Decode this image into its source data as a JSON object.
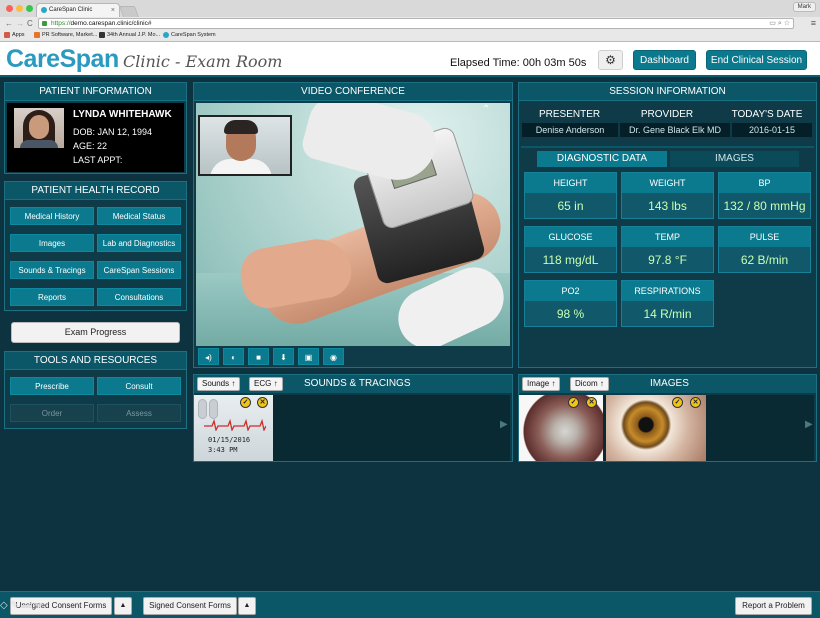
{
  "browser": {
    "tab_title": "CareSpan Clinic",
    "tab_close": "×",
    "profile": "Mark",
    "url_scheme": "https://",
    "url_rest": "demo.carespan.clinic/clinic#",
    "url_icons": "▭ ⌕ ☆",
    "menu_icon": "≡",
    "nav_back": "←",
    "nav_forward": "→",
    "nav_reload": "C",
    "bookmarks": [
      "Apps",
      "PR Software, Market...",
      "34th Annual J.P. Mo...",
      "CareSpan System"
    ]
  },
  "header": {
    "brand": "CareSpan",
    "subtitle": "Clinic - Exam Room",
    "elapsed": "Elapsed Time: 00h 03m 50s",
    "gear": "⚙",
    "dashboard_label": "Dashboard",
    "end_session_label": "End Clinical Session"
  },
  "patient": {
    "heading": "PATIENT INFORMATION",
    "name": "LYNDA WHITEHAWK",
    "dob": "DOB: JAN 12, 1994",
    "age": "AGE: 22",
    "last_appt": "LAST APPT:"
  },
  "health_record": {
    "heading": "PATIENT HEALTH RECORD",
    "buttons": [
      "Medical History",
      "Medical Status",
      "Images",
      "Lab and Diagnostics",
      "Sounds & Tracings",
      "CareSpan Sessions",
      "Reports",
      "Consultations"
    ]
  },
  "exam_progress": "Exam Progress",
  "tools": {
    "heading": "TOOLS AND RESOURCES",
    "prescribe": "Prescribe",
    "consult": "Consult",
    "order": "Order",
    "assess": "Assess"
  },
  "video": {
    "heading": "VIDEO CONFERENCE",
    "chevron": "⌃",
    "controls": [
      "◂)",
      "◐",
      "■",
      "⬇",
      "▣",
      "◉"
    ]
  },
  "session": {
    "heading": "SESSION INFORMATION",
    "presenter_label": "PRESENTER",
    "provider_label": "PROVIDER",
    "date_label": "TODAY'S DATE",
    "presenter": "Denise Anderson",
    "provider": "Dr. Gene Black Elk MD",
    "date": "2016-01-15",
    "tab_diagnostic": "DIAGNOSTIC DATA",
    "tab_images": "IMAGES",
    "vitals": [
      {
        "label": "HEIGHT",
        "value": "65 in"
      },
      {
        "label": "WEIGHT",
        "value": "143 lbs"
      },
      {
        "label": "BP",
        "value": "132 / 80 mmHg"
      },
      {
        "label": "GLUCOSE",
        "value": "118 mg/dL"
      },
      {
        "label": "TEMP",
        "value": "97.8 °F"
      },
      {
        "label": "PULSE",
        "value": "62 B/min"
      },
      {
        "label": "PO2",
        "value": "98 %"
      },
      {
        "label": "RESPIRATIONS",
        "value": "14 R/min"
      }
    ]
  },
  "sounds": {
    "heading": "SOUNDS & TRACINGS",
    "filter1": "Sounds",
    "filter2": "ECG",
    "up_arrow": "↑",
    "thumb_date": "01/15/2016",
    "thumb_time": "3:43 PM",
    "check": "✓",
    "remove": "✕",
    "next": "▶"
  },
  "images": {
    "heading": "IMAGES",
    "filter1": "Image",
    "filter2": "Dicom",
    "up_arrow": "↑",
    "check": "✓",
    "remove": "✕",
    "next": "▶"
  },
  "footer": {
    "unsigned": "Unsigned Consent Forms",
    "signed": "Signed Consent Forms",
    "caret": "▲",
    "report": "Report a Problem",
    "tool_icons": "◇ ✎ ▬ ➜"
  },
  "colors": {
    "brand_blue": "#2a9ac0",
    "accent_teal": "#0c7a8e",
    "panel_bg": "#0f3a47",
    "vital_value": "#c8ffb2"
  }
}
